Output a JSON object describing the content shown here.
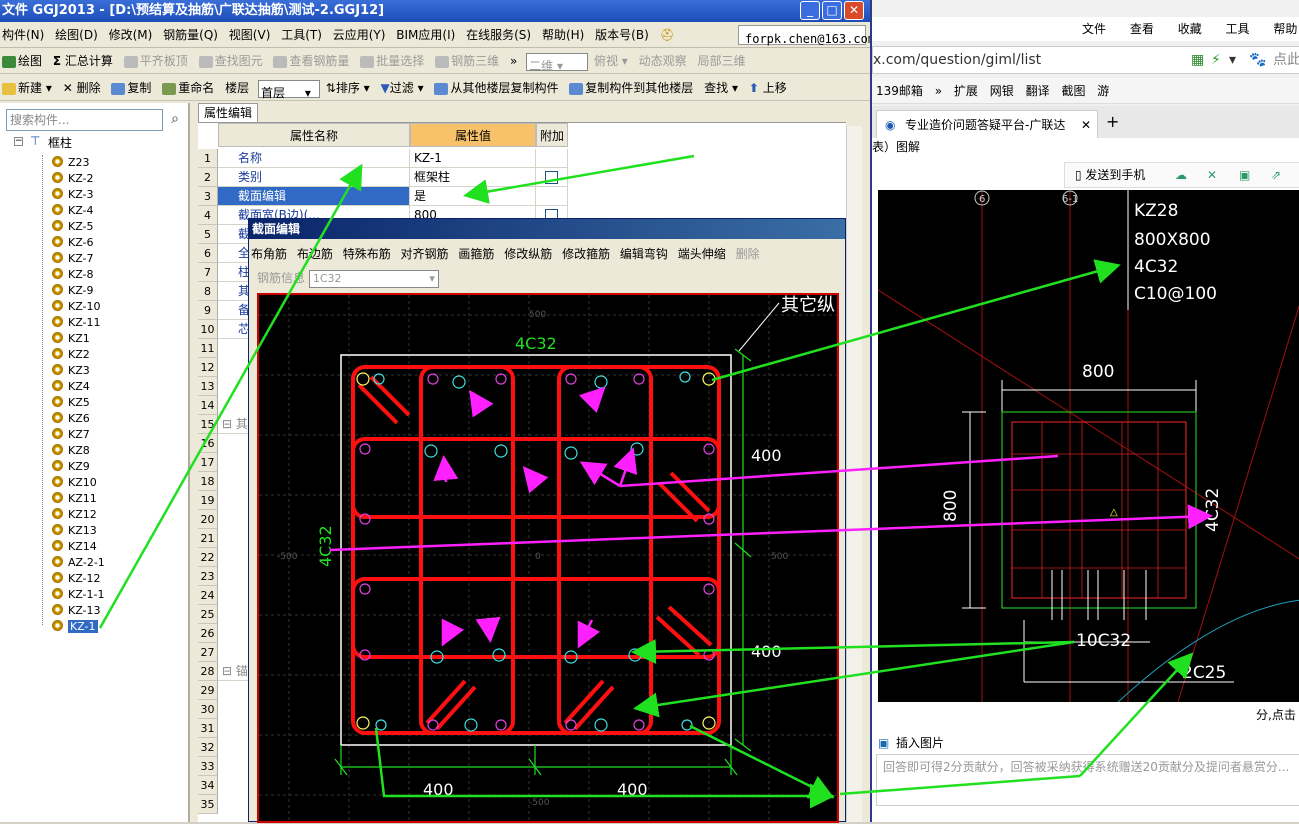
{
  "app": {
    "title": "文件 GGJ2013 - [D:\\预结算及抽筋\\广联达抽筋\\测试-2.GGJ12]",
    "win_min": "_",
    "win_max": "□",
    "win_close": "✕",
    "menu": [
      "构件(N)",
      "绘图(D)",
      "修改(M)",
      "钢筋量(Q)",
      "视图(V)",
      "工具(T)",
      "云应用(Y)",
      "BIM应用(I)",
      "在线服务(S)",
      "帮助(H)",
      "版本号(B)"
    ],
    "email": "forpk.chen@163.com",
    "toolbar1": {
      "draw": "绘图",
      "sum": "汇总计算",
      "flush_slab": "平齐板顶",
      "find_element": "查找图元",
      "view_rebar": "查看钢筋量",
      "batch_select": "批量选择",
      "rebar_3d": "钢筋三维",
      "view_mode": "二维",
      "top_view": "俯视",
      "dynamic_view": "动态观察",
      "local_3d": "局部三维"
    },
    "toolbar2": {
      "new": "新建",
      "delete": "删除",
      "copy": "复制",
      "rename": "重命名",
      "floor_label": "楼层",
      "floor_value": "首层",
      "sort": "排序",
      "filter": "过滤",
      "copy_from_floor": "从其他楼层复制构件",
      "copy_to_floor": "复制构件到其他楼层",
      "find": "查找",
      "move_up": "上移"
    }
  },
  "tree": {
    "search_placeholder": "搜索构件...",
    "root": "框柱",
    "items": [
      "Z23",
      "KZ-2",
      "KZ-3",
      "KZ-4",
      "KZ-5",
      "KZ-6",
      "KZ-7",
      "KZ-8",
      "KZ-9",
      "KZ-10",
      "KZ-11",
      "KZ1",
      "KZ2",
      "KZ3",
      "KZ4",
      "KZ5",
      "KZ6",
      "KZ7",
      "KZ8",
      "KZ9",
      "KZ10",
      "KZ11",
      "KZ12",
      "KZ13",
      "KZ14",
      "AZ-2-1",
      "KZ-12",
      "KZ-1-1",
      "KZ-13",
      "KZ-1"
    ],
    "selected": "KZ-1"
  },
  "props": {
    "tab": "属性编辑",
    "headers": [
      "属性名称",
      "属性值",
      "附加"
    ],
    "rows": [
      {
        "name": "名称",
        "value": "KZ-1"
      },
      {
        "name": "类别",
        "value": "框架柱"
      },
      {
        "name": "截面编辑",
        "value": "是"
      },
      {
        "name": "截面宽(B边)(...",
        "value": "800"
      },
      {
        "name": "截",
        "value": ""
      },
      {
        "name": "全",
        "value": ""
      },
      {
        "name": "柱",
        "value": ""
      },
      {
        "name": "其",
        "value": ""
      },
      {
        "name": "备",
        "value": ""
      },
      {
        "name": "芯",
        "value": ""
      }
    ],
    "row_numbers": [
      "1",
      "2",
      "3",
      "4",
      "5",
      "6",
      "7",
      "8",
      "9",
      "10",
      "11",
      "12",
      "13",
      "14",
      "15",
      "16",
      "17",
      "18",
      "19",
      "20",
      "21",
      "22",
      "23",
      "24",
      "25",
      "26",
      "27",
      "28",
      "29",
      "30",
      "31",
      "32",
      "33",
      "34",
      "35"
    ],
    "group_15": "其",
    "group_28": "锚"
  },
  "dialog": {
    "title": "截面编辑",
    "tools": [
      "布角筋",
      "布边筋",
      "特殊布筋",
      "对齐钢筋",
      "画箍筋",
      "修改纵筋",
      "修改箍筋",
      "编辑弯钩",
      "端头伸缩"
    ],
    "tool_disabled": "删除",
    "rebar_info_label": "钢筋信息",
    "rebar_info_value": "1C32",
    "canvas": {
      "top_label": "4C32",
      "left_label": "4C32",
      "other_label": "其它纵",
      "dim_top": "400",
      "dim_bottom": "400",
      "dim_left_bottom": "400",
      "dim_right_bottom": "400",
      "coord_top": "500",
      "coord_left": "-500",
      "coord_right": "500",
      "coord_center": "0",
      "coord_bottom": "-500"
    }
  },
  "browser": {
    "menu": [
      "文件",
      "查看",
      "收藏",
      "工具",
      "帮助"
    ],
    "address": "x.com/question/giml/list",
    "search_hint": "点此",
    "favorites": [
      "139邮箱",
      "扩展",
      "网银",
      "翻译",
      "截图",
      "游"
    ],
    "tab_title": "专业造价问题答疑平台-广联达",
    "tab_close": "✕",
    "tab_new": "+",
    "page_fragment": "表）图解",
    "send_to_phone": "发送到手机",
    "cad": {
      "name": "KZ28",
      "size": "800X800",
      "corner_bars": "4C32",
      "stirrup": "C10@100",
      "dim_top": "800",
      "dim_left": "800",
      "side_bars": "4C32",
      "bottom_bars": "10C32",
      "extra_bars": "2C25",
      "axis_6": "6",
      "axis_6_1": "6-1"
    },
    "side_note": "分,点击",
    "insert_image": "插入图片",
    "reply_placeholder": "回答即可得2分贡献分，回答被采纳获得系统赠送20贡献分及提问者悬赏分..."
  }
}
